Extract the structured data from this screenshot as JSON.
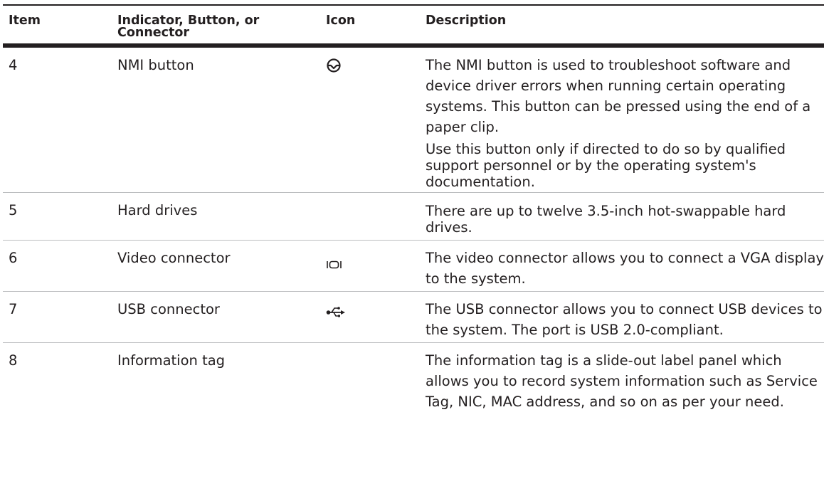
{
  "table": {
    "headers": {
      "item": "Item",
      "indicator": "Indicator, Button, or Connector",
      "icon": "Icon",
      "description": "Description"
    },
    "rows": [
      {
        "item": "4",
        "name": "NMI button",
        "icon": "nmi-icon",
        "description": [
          "The NMI button is used to troubleshoot software and device driver errors when running certain operating systems. This button can be pressed using the end of a paper clip.",
          "Use this button only if directed to do so by qualified support personnel or by the operating system's documentation."
        ]
      },
      {
        "item": "5",
        "name": "Hard drives",
        "icon": "",
        "description": [
          "There are up to twelve 3.5-inch hot-swappable hard drives."
        ]
      },
      {
        "item": "6",
        "name": "Video connector",
        "icon": "vga-icon",
        "description": [
          "The video connector allows you to connect a VGA display to the system."
        ]
      },
      {
        "item": "7",
        "name": "USB connector",
        "icon": "usb-icon",
        "description": [
          "The USB connector allows you to connect USB devices to the system. The port is USB 2.0-compliant."
        ]
      },
      {
        "item": "8",
        "name": "Information tag",
        "icon": "",
        "description": [
          "The information tag is a slide-out label panel which allows you to record system information such as Service Tag, NIC, MAC address, and so on as per your need."
        ]
      }
    ]
  }
}
